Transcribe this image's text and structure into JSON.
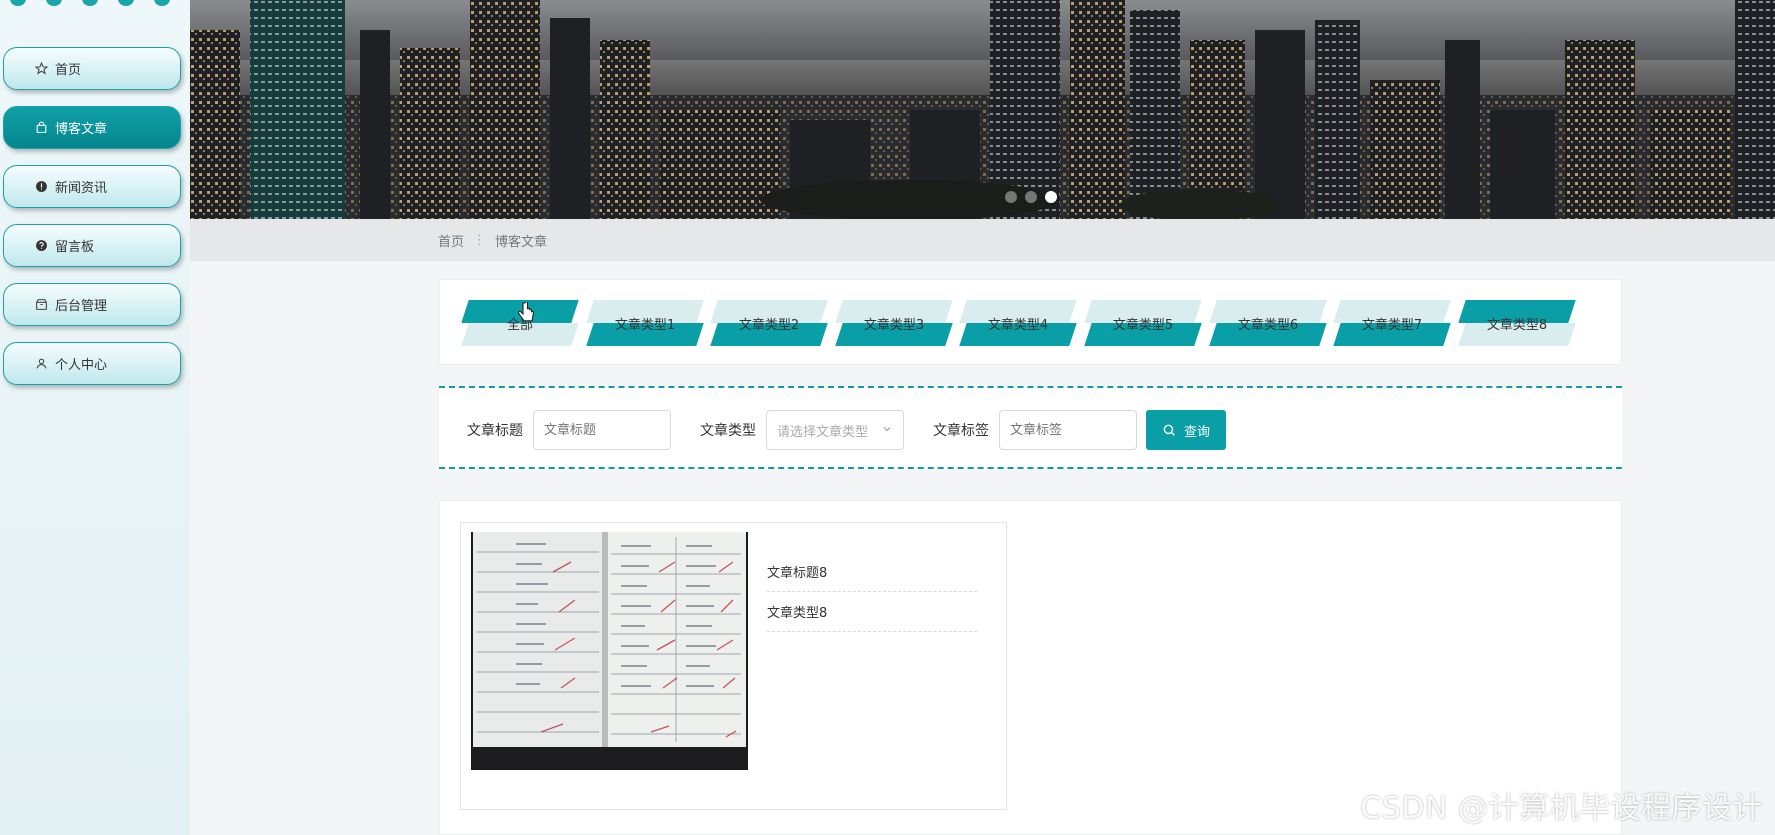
{
  "sidebar": {
    "items": [
      {
        "label": "首页",
        "icon": "star-icon"
      },
      {
        "label": "博客文章",
        "icon": "bag-icon",
        "active": true
      },
      {
        "label": "新闻资讯",
        "icon": "info-icon"
      },
      {
        "label": "留言板",
        "icon": "help-icon"
      },
      {
        "label": "后台管理",
        "icon": "package-icon"
      },
      {
        "label": "个人中心",
        "icon": "user-icon"
      }
    ]
  },
  "banner": {
    "slide_count": 3,
    "active_slide": 3
  },
  "breadcrumb": {
    "home": "首页",
    "separator": "⋮",
    "current": "博客文章"
  },
  "tabs": {
    "items": [
      {
        "label": "全部",
        "selected": true
      },
      {
        "label": "文章类型1"
      },
      {
        "label": "文章类型2"
      },
      {
        "label": "文章类型3"
      },
      {
        "label": "文章类型4"
      },
      {
        "label": "文章类型5"
      },
      {
        "label": "文章类型6"
      },
      {
        "label": "文章类型7"
      },
      {
        "label": "文章类型8"
      }
    ]
  },
  "search": {
    "title_label": "文章标题",
    "title_placeholder": "文章标题",
    "type_label": "文章类型",
    "type_placeholder": "请选择文章类型",
    "tag_label": "文章标签",
    "tag_placeholder": "文章标签",
    "button_label": "查询"
  },
  "results": {
    "articles": [
      {
        "title": "文章标题8",
        "type": "文章类型8"
      }
    ]
  },
  "watermark": "CSDN @计算机毕设程序设计",
  "colors": {
    "accent": "#0a9fa6",
    "tab_light": "#d9ecee",
    "page_bg": "#f3f5f6"
  }
}
